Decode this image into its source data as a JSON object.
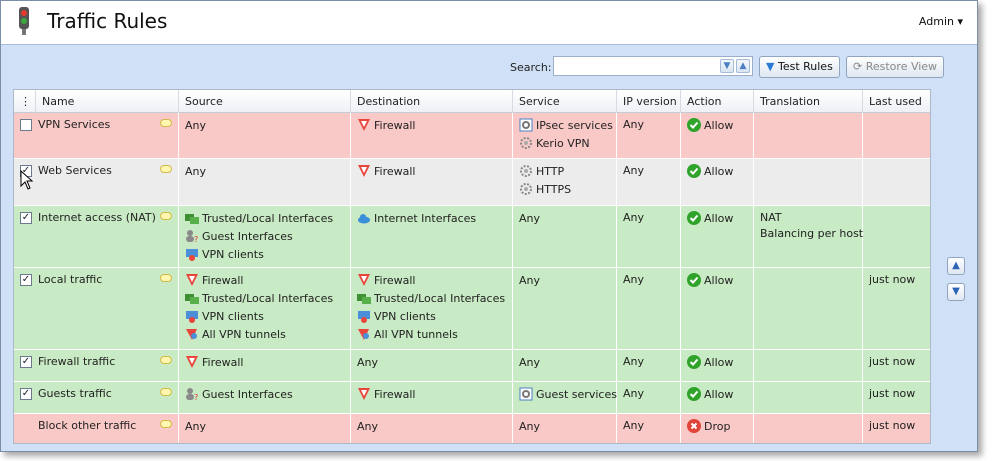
{
  "header": {
    "title": "Traffic Rules",
    "admin": "Admin ▾"
  },
  "toolbar": {
    "search_label": "Search:",
    "search_value": "",
    "test_rules": "Test Rules",
    "restore_view": "Restore View"
  },
  "columns": [
    "Name",
    "Source",
    "Destination",
    "Service",
    "IP version",
    "Action",
    "Translation",
    "Last used"
  ],
  "rows": [
    {
      "checked": false,
      "color": "red",
      "name": "VPN Services",
      "source": [
        "Any"
      ],
      "destination": [
        "Firewall"
      ],
      "service": [
        "IPsec services",
        "Kerio VPN"
      ],
      "ip": "Any",
      "action": "Allow",
      "translation": [],
      "last": ""
    },
    {
      "checked": true,
      "color": "grey",
      "name": "Web Services",
      "source": [
        "Any"
      ],
      "destination": [
        "Firewall"
      ],
      "service": [
        "HTTP",
        "HTTPS"
      ],
      "ip": "Any",
      "action": "Allow",
      "translation": [],
      "last": ""
    },
    {
      "checked": true,
      "color": "green",
      "name": "Internet access (NAT)",
      "source": [
        "Trusted/Local Interfaces",
        "Guest Interfaces",
        "VPN clients"
      ],
      "destination": [
        "Internet Interfaces"
      ],
      "service": [
        "Any"
      ],
      "ip": "Any",
      "action": "Allow",
      "translation": [
        "NAT",
        "Balancing per host"
      ],
      "last": ""
    },
    {
      "checked": true,
      "color": "green",
      "name": "Local traffic",
      "source": [
        "Firewall",
        "Trusted/Local Interfaces",
        "VPN clients",
        "All VPN tunnels"
      ],
      "destination": [
        "Firewall",
        "Trusted/Local Interfaces",
        "VPN clients",
        "All VPN tunnels"
      ],
      "service": [
        "Any"
      ],
      "ip": "Any",
      "action": "Allow",
      "translation": [],
      "last": "just now"
    },
    {
      "checked": true,
      "color": "green",
      "name": "Firewall traffic",
      "source": [
        "Firewall"
      ],
      "destination": [
        "Any"
      ],
      "service": [
        "Any"
      ],
      "ip": "Any",
      "action": "Allow",
      "translation": [],
      "last": "just now"
    },
    {
      "checked": true,
      "color": "green",
      "name": "Guests traffic",
      "source": [
        "Guest Interfaces"
      ],
      "destination": [
        "Firewall"
      ],
      "service": [
        "Guest services"
      ],
      "ip": "Any",
      "action": "Allow",
      "translation": [],
      "last": "just now"
    },
    {
      "checked": null,
      "color": "red",
      "name": "Block other traffic",
      "source": [
        "Any"
      ],
      "destination": [
        "Any"
      ],
      "service": [
        "Any"
      ],
      "ip": "Any",
      "action": "Drop",
      "translation": [],
      "last": "just now"
    }
  ],
  "colors": {
    "allow": "#2fa32a",
    "drop": "#e0443a",
    "red_row": "#f9c9c8",
    "green_row": "#c8eac4",
    "grey_row": "#ececec",
    "panel": "#cfe0f7"
  }
}
